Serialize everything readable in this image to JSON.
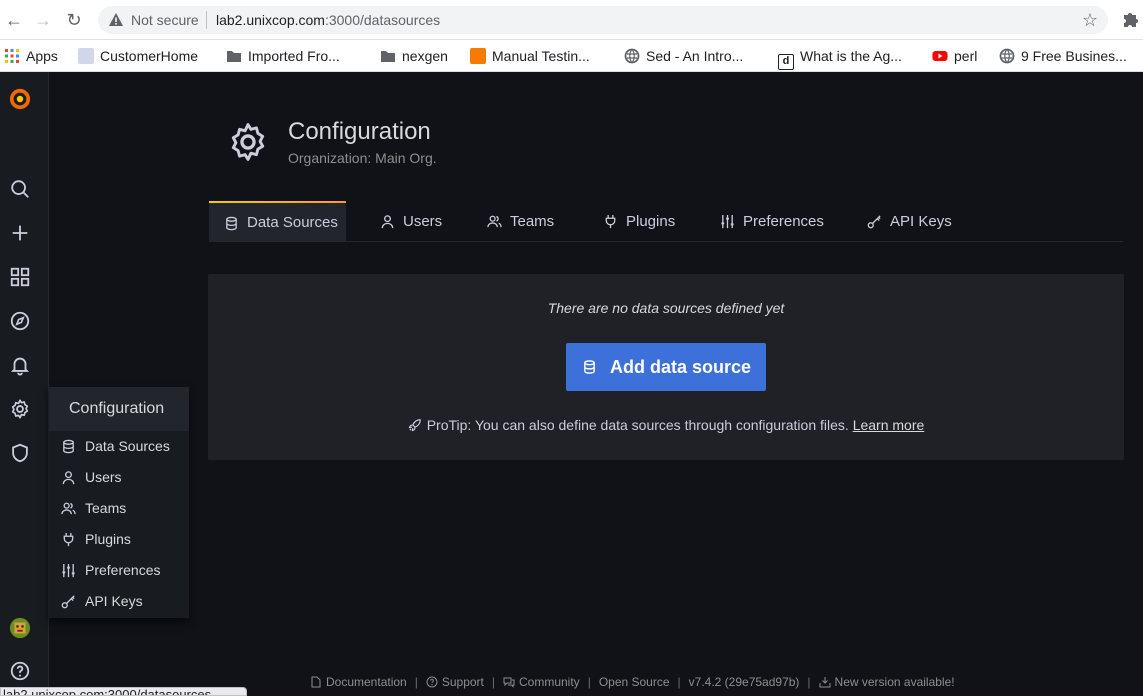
{
  "browser": {
    "security_label": "Not secure",
    "url_host": "lab2.unixcop.com",
    "url_rest": ":3000/datasources",
    "bookmarks": [
      {
        "label": "Apps",
        "color": "#4285f4"
      },
      {
        "label": "CustomerHome",
        "color": "#1a73e8"
      },
      {
        "label": "Imported Fro...",
        "color": "#5f6368"
      },
      {
        "label": "nexgen",
        "color": "#5f6368"
      },
      {
        "label": "Manual Testin...",
        "color": "#f57c00"
      },
      {
        "label": "Sed - An Intro...",
        "color": "#5f6368"
      },
      {
        "label": "What is the Ag...",
        "color": "#202124"
      },
      {
        "label": "perl",
        "color": "#ff0000"
      },
      {
        "label": "9 Free Busines...",
        "color": "#5f6368"
      }
    ]
  },
  "header": {
    "title": "Configuration",
    "subtitle": "Organization: Main Org."
  },
  "tabs": [
    {
      "label": "Data Sources",
      "icon": "database-icon",
      "active": true
    },
    {
      "label": "Users",
      "icon": "user-icon"
    },
    {
      "label": "Teams",
      "icon": "users-icon"
    },
    {
      "label": "Plugins",
      "icon": "plug-icon"
    },
    {
      "label": "Preferences",
      "icon": "sliders-icon"
    },
    {
      "label": "API Keys",
      "icon": "key-icon"
    }
  ],
  "empty_state": {
    "message": "There are no data sources defined yet",
    "button_label": "Add data source",
    "protip": "ProTip: You can also define data sources through configuration files.",
    "learn_more": "Learn more"
  },
  "flyout": {
    "title": "Configuration",
    "items": [
      "Data Sources",
      "Users",
      "Teams",
      "Plugins",
      "Preferences",
      "API Keys"
    ]
  },
  "footer": {
    "documentation": "Documentation",
    "support": "Support",
    "community": "Community",
    "open_source": "Open Source",
    "version": "v7.4.2 (29e75ad97b)",
    "new_version": "New version available!"
  },
  "status_url": "lab2.unixcop.com:3000/datasources",
  "colors": {
    "accent_button": "#3d71d9",
    "background": "#111217",
    "panel": "#1f2126"
  }
}
